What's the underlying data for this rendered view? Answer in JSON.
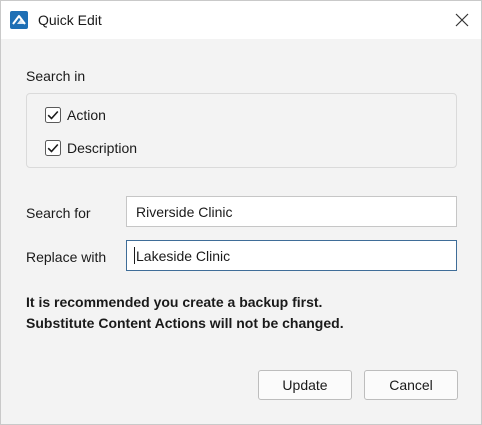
{
  "window": {
    "title": "Quick Edit",
    "accent_color": "#1e6fb5"
  },
  "search_in": {
    "label": "Search in",
    "options": [
      {
        "label": "Action",
        "checked": true
      },
      {
        "label": "Description",
        "checked": true
      }
    ]
  },
  "fields": {
    "search_for": {
      "label": "Search for",
      "value": "Riverside Clinic"
    },
    "replace_with": {
      "label": "Replace with",
      "value": "Lakeside Clinic"
    }
  },
  "warning": {
    "line1": "It is recommended you create a backup first.",
    "line2": "Substitute Content Actions will not be changed."
  },
  "buttons": {
    "update": "Update",
    "cancel": "Cancel"
  }
}
